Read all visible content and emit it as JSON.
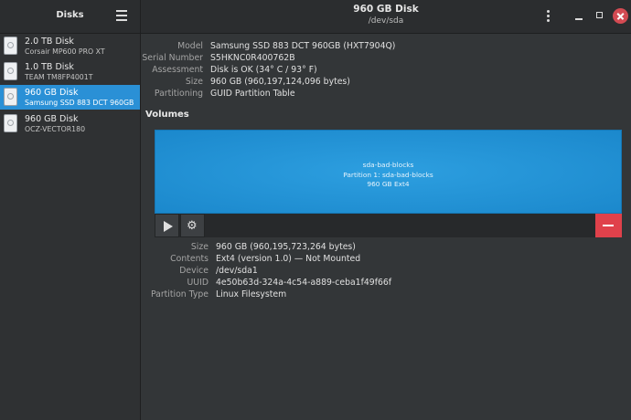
{
  "sidebar": {
    "title": "Disks",
    "disks": [
      {
        "name": "2.0 TB Disk",
        "model": "Corsair MP600 PRO XT",
        "selected": false
      },
      {
        "name": "1.0 TB Disk",
        "model": "TEAM TM8FP4001T",
        "selected": false
      },
      {
        "name": "960 GB Disk",
        "model": "Samsung SSD 883 DCT 960GB",
        "selected": true
      },
      {
        "name": "960 GB Disk",
        "model": "OCZ-VECTOR180",
        "selected": false
      }
    ]
  },
  "header": {
    "title": "960 GB Disk",
    "subtitle": "/dev/sda"
  },
  "disk_info": [
    {
      "label": "Model",
      "value": "Samsung SSD 883 DCT 960GB (HXT7904Q)"
    },
    {
      "label": "Serial Number",
      "value": "S5HKNC0R400762B"
    },
    {
      "label": "Assessment",
      "value": "Disk is OK (34° C / 93° F)"
    },
    {
      "label": "Size",
      "value": "960 GB (960,197,124,096 bytes)"
    },
    {
      "label": "Partitioning",
      "value": "GUID Partition Table"
    }
  ],
  "volumes": {
    "title": "Volumes",
    "partition": {
      "line1": "sda-bad-blocks",
      "line2": "Partition 1: sda-bad-blocks",
      "line3": "960 GB Ext4"
    }
  },
  "partition_info": [
    {
      "label": "Size",
      "value": "960 GB (960,195,723,264 bytes)"
    },
    {
      "label": "Contents",
      "value": "Ext4 (version 1.0) — Not Mounted"
    },
    {
      "label": "Device",
      "value": "/dev/sda1"
    },
    {
      "label": "UUID",
      "value": "4e50b63d-324a-4c54-a889-ceba1f49f66f"
    },
    {
      "label": "Partition Type",
      "value": "Linux Filesystem"
    }
  ],
  "colors": {
    "accent": "#2a90d6",
    "volume": "#1d8ed3",
    "danger": "#e0414b"
  },
  "icons": {
    "disk": "drive-harddisk-icon",
    "menu": "hamburger-menu-icon",
    "kebab": "more-vertical-icon",
    "mount": "play-icon",
    "settings": "gear-icon",
    "delete": "minus-icon"
  }
}
